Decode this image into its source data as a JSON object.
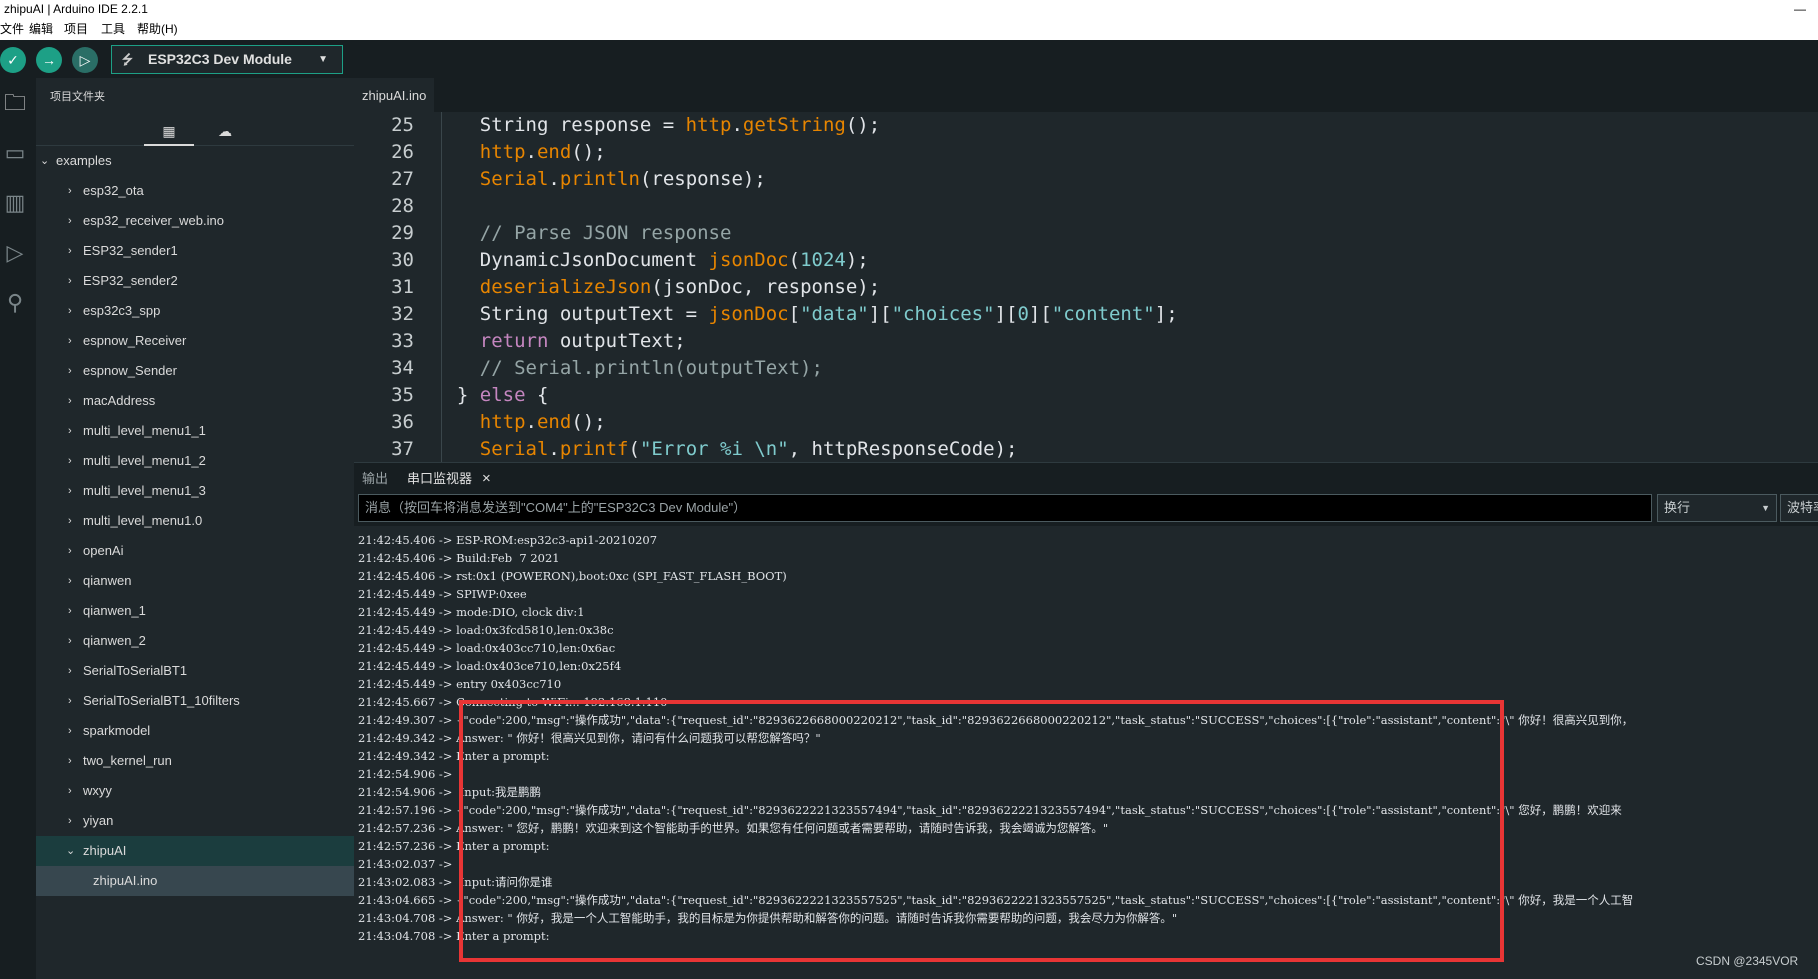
{
  "window": {
    "title": "zhipuAI | Arduino IDE 2.2.1",
    "minimize": "—"
  },
  "menu": {
    "file": "文件",
    "edit": "编辑",
    "project": "项目",
    "tools": "工具",
    "help": "帮助(H)"
  },
  "toolbar": {
    "board": "ESP32C3 Dev Module",
    "verify_icon": "✓",
    "upload_icon": "→",
    "debug_icon": "▷"
  },
  "sidebar": {
    "title": "项目文件夹",
    "items": [
      {
        "label": "examples",
        "expanded": true
      },
      {
        "label": "esp32_ota"
      },
      {
        "label": "esp32_receiver_web.ino"
      },
      {
        "label": "ESP32_sender1"
      },
      {
        "label": "ESP32_sender2"
      },
      {
        "label": "esp32c3_spp"
      },
      {
        "label": "espnow_Receiver"
      },
      {
        "label": "espnow_Sender"
      },
      {
        "label": "macAddress"
      },
      {
        "label": "multi_level_menu1_1"
      },
      {
        "label": "multi_level_menu1_2"
      },
      {
        "label": "multi_level_menu1_3"
      },
      {
        "label": "multi_level_menu1.0"
      },
      {
        "label": "openAi"
      },
      {
        "label": "qianwen"
      },
      {
        "label": "qianwen_1"
      },
      {
        "label": "qianwen_2"
      },
      {
        "label": "SerialToSerialBT1"
      },
      {
        "label": "SerialToSerialBT1_10filters"
      },
      {
        "label": "sparkmodel"
      },
      {
        "label": "two_kernel_run"
      },
      {
        "label": "wxyy"
      },
      {
        "label": "yiyan"
      },
      {
        "label": "zhipuAI",
        "expanded": true
      },
      {
        "label": "zhipuAI.ino"
      }
    ]
  },
  "editor": {
    "tab": "zhipuAI.ino",
    "line_numbers": [
      "25",
      "26",
      "27",
      "28",
      "29",
      "30",
      "31",
      "32",
      "33",
      "34",
      "35",
      "36",
      "37"
    ]
  },
  "panel": {
    "output_tab": "输出",
    "serial_tab": "串口监视器",
    "close": "×",
    "message_placeholder": "消息（按回车将消息发送到\"COM4\"上的\"ESP32C3 Dev Module\"）",
    "line_ending": "换行",
    "baud": "波特率"
  },
  "serial_lines": [
    "21:42:45.406 -> ESP-ROM:esp32c3-api1-20210207",
    "21:42:45.406 -> Build:Feb  7 2021",
    "21:42:45.406 -> rst:0x1 (POWERON),boot:0xc (SPI_FAST_FLASH_BOOT)",
    "21:42:45.449 -> SPIWP:0xee",
    "21:42:45.449 -> mode:DIO, clock div:1",
    "21:42:45.449 -> load:0x3fcd5810,len:0x38c",
    "21:42:45.449 -> load:0x403cc710,len:0x6ac",
    "21:42:45.449 -> load:0x403ce710,len:0x25f4",
    "21:42:45.449 -> entry 0x403cc710",
    "21:42:45.667 -> Connecting to WiFi... 192.168.1.110",
    "21:42:49.307 -> {\"code\":200,\"msg\":\"操作成功\",\"data\":{\"request_id\":\"8293622668000220212\",\"task_id\":\"8293622668000220212\",\"task_status\":\"SUCCESS\",\"choices\":[{\"role\":\"assistant\",\"content\":\"\\\" 你好！很高兴见到你，",
    "21:42:49.342 -> Answer: \" 你好！很高兴见到你，请问有什么问题我可以帮您解答吗？\"",
    "21:42:49.342 -> Enter a prompt:",
    "21:42:54.906 -> ",
    "21:42:54.906 ->  Input:我是鹏鹏",
    "21:42:57.196 -> {\"code\":200,\"msg\":\"操作成功\",\"data\":{\"request_id\":\"8293622221323557494\",\"task_id\":\"8293622221323557494\",\"task_status\":\"SUCCESS\",\"choices\":[{\"role\":\"assistant\",\"content\":\"\\\" 您好，鹏鹏！欢迎来",
    "21:42:57.236 -> Answer: \" 您好，鹏鹏！欢迎来到这个智能助手的世界。如果您有任何问题或者需要帮助，请随时告诉我，我会竭诚为您解答。\"",
    "21:42:57.236 -> Enter a prompt:",
    "21:43:02.037 -> ",
    "21:43:02.083 ->  Input:请问你是谁",
    "21:43:04.665 -> {\"code\":200,\"msg\":\"操作成功\",\"data\":{\"request_id\":\"8293622221323557525\",\"task_id\":\"8293622221323557525\",\"task_status\":\"SUCCESS\",\"choices\":[{\"role\":\"assistant\",\"content\":\"\\\" 你好，我是一个人工智",
    "21:43:04.708 -> Answer: \" 你好，我是一个人工智能助手，我的目标是为你提供帮助和解答你的问题。请随时告诉我你需要帮助的问题，我会尽力为你解答。\"",
    "21:43:04.708 -> Enter a prompt:"
  ],
  "watermark": "CSDN @2345VOR",
  "colors": {
    "accent": "#1da086",
    "highlight_box": "#e83535"
  }
}
